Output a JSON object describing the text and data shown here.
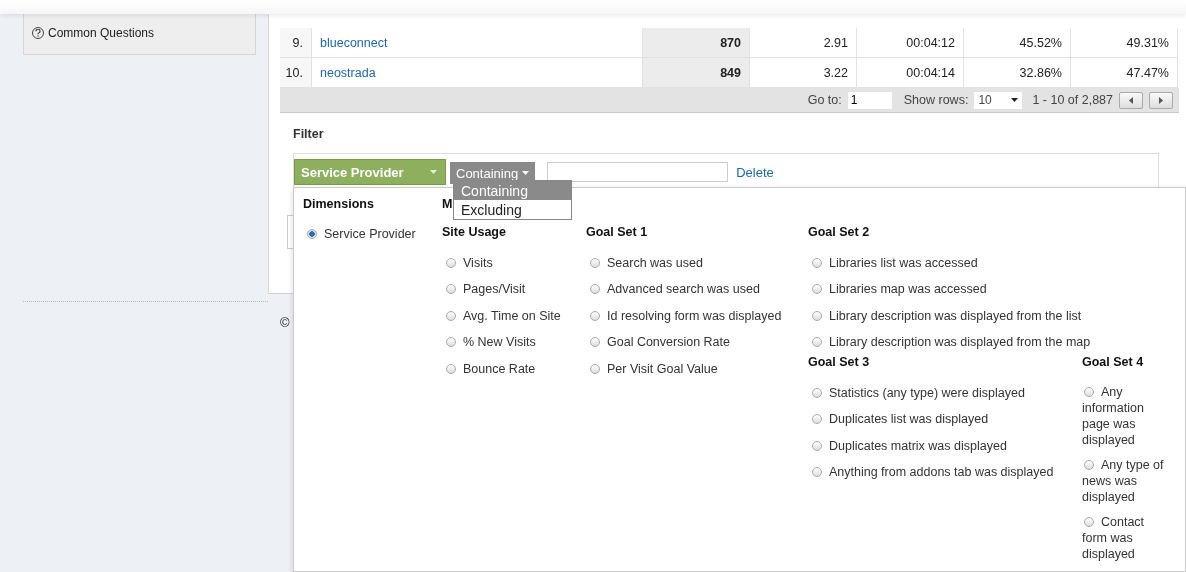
{
  "sidebar": {
    "items": [
      {
        "label": "Common Questions"
      }
    ]
  },
  "table": {
    "rows": [
      {
        "index": "9.",
        "name": "blueconnect",
        "visits": "870",
        "pages_per_visit": "2.91",
        "avg_time": "00:04:12",
        "new_visits": "45.52%",
        "bounce_rate": "49.31%"
      },
      {
        "index": "10.",
        "name": "neostrada",
        "visits": "849",
        "pages_per_visit": "3.22",
        "avg_time": "00:04:14",
        "new_visits": "32.86%",
        "bounce_rate": "47.47%"
      }
    ]
  },
  "pagination": {
    "goto_label": "Go to:",
    "goto_value": "1",
    "show_rows_label": "Show rows:",
    "show_rows_value": "10",
    "range": "1 - 10 of 2,887"
  },
  "filter": {
    "title": "Filter",
    "dimension_button": "Service Provider",
    "mode_button": "Containing",
    "delete_link": "Delete",
    "mode_menu": [
      {
        "label": "Containing",
        "selected": true
      },
      {
        "label": "Excluding",
        "selected": false
      }
    ]
  },
  "picker": {
    "dimensions": {
      "title": "Dimensions",
      "items": [
        {
          "label": "Service Provider",
          "selected": true
        }
      ]
    },
    "metrics_heading": "M",
    "groups": [
      {
        "title": "Site Usage",
        "items": [
          {
            "label": "Visits",
            "selected": false
          },
          {
            "label": "Pages/Visit",
            "selected": false
          },
          {
            "label": "Avg. Time on Site",
            "selected": false
          },
          {
            "label": "% New Visits",
            "selected": false
          },
          {
            "label": "Bounce Rate",
            "selected": false
          }
        ]
      },
      {
        "title": "Goal Set 1",
        "items": [
          {
            "label": "Search was used",
            "selected": false
          },
          {
            "label": "Advanced search was used",
            "selected": false
          },
          {
            "label": "Id resolving form was displayed",
            "selected": false
          },
          {
            "label": "Goal Conversion Rate",
            "selected": false
          },
          {
            "label": "Per Visit Goal Value",
            "selected": false
          }
        ]
      },
      {
        "title": "Goal Set 2",
        "items": [
          {
            "label": "Libraries list was accessed",
            "selected": false
          },
          {
            "label": "Libraries map was accessed",
            "selected": false
          },
          {
            "label": "Library description was displayed from the list",
            "selected": false
          },
          {
            "label": "Library description was displayed from the map",
            "selected": false
          }
        ]
      },
      {
        "title": "Goal Set 3",
        "items": [
          {
            "label": "Statistics (any type) were displayed",
            "selected": false
          },
          {
            "label": "Duplicates list was displayed",
            "selected": false
          },
          {
            "label": "Duplicates matrix was displayed",
            "selected": false
          },
          {
            "label": "Anything from addons tab was displayed",
            "selected": false
          }
        ]
      },
      {
        "title": "Goal Set 4",
        "items": [
          {
            "label": "Any information page was displayed",
            "selected": false
          },
          {
            "label": "Any type of news was displayed",
            "selected": false
          },
          {
            "label": "Contact form was displayed",
            "selected": false
          }
        ]
      }
    ]
  },
  "footer": {
    "copyright": "©"
  }
}
